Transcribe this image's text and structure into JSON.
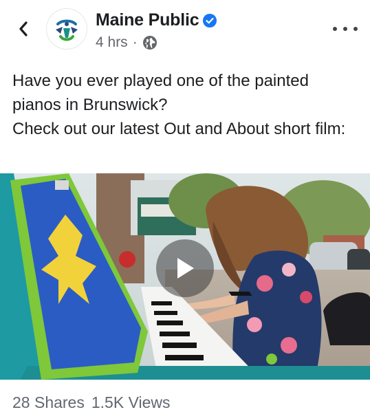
{
  "header": {
    "back_icon": "chevron-left-icon",
    "page_name": "Maine Public",
    "verified_icon": "verified-badge-icon",
    "time": "4 hrs",
    "separator": "·",
    "privacy_icon": "globe-icon",
    "more_icon": "more-horizontal-icon"
  },
  "post": {
    "text_lines": [
      "Have you ever played one of the painted pianos in Brunswick?",
      "Check out our latest Out and About short film:"
    ]
  },
  "video": {
    "play_icon": "play-icon",
    "description": "",
    "accent_color": "#7ec83a"
  },
  "stats": {
    "shares": "28 Shares",
    "views": "1.5K Views"
  },
  "colors": {
    "verified": "#1877f2",
    "secondary_text": "#65676b"
  }
}
